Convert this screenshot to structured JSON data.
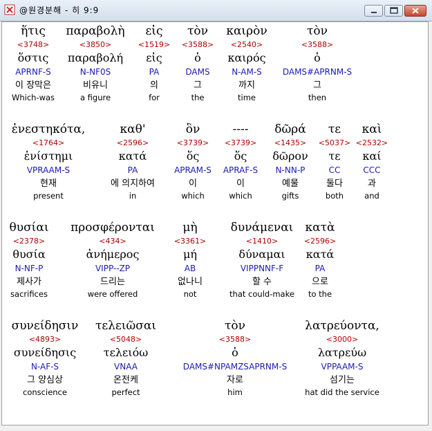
{
  "window": {
    "title": "@원경분해 - 히 9:9",
    "minimize_icon": "minimize-icon",
    "maximize_icon": "maximize-icon",
    "close_icon": "close-icon"
  },
  "words": [
    {
      "greek": "ἥτις",
      "strong": "<3748>",
      "lemma": "ὅστις",
      "morph": "APRNF-S",
      "korean": "이 장막은",
      "english": "Which-was"
    },
    {
      "greek": "παραβολὴ",
      "strong": "<3850>",
      "lemma": "παραβολή",
      "morph": "N-NF0S",
      "korean": "비유니",
      "english": "a figure"
    },
    {
      "greek": "εἰς",
      "strong": "<1519>",
      "lemma": "εἰς",
      "morph": "PA",
      "korean": "의",
      "english": "for"
    },
    {
      "greek": "τὸν",
      "strong": "<3588>",
      "lemma": "ὁ",
      "morph": "DAMS",
      "korean": "그",
      "english": "the"
    },
    {
      "greek": "καιρὸν",
      "strong": "<2540>",
      "lemma": "καιρός",
      "morph": "N-AM-S",
      "korean": "까지",
      "english": "time"
    },
    {
      "greek": "τὸν",
      "strong": "<3588>",
      "lemma": "ὁ",
      "morph": "DAMS#APRNM-S",
      "korean": "그",
      "english": "then"
    },
    {
      "greek": "ἐνεστηκότα,",
      "strong": "<1764>",
      "lemma": "ἐνίστημι",
      "morph": "VPRAAM-S",
      "korean": "현재",
      "english": "present"
    },
    {
      "greek": "καθ'",
      "strong": "<2596>",
      "lemma": "κατά",
      "morph": "PA",
      "korean": "에 의지하여",
      "english": "in"
    },
    {
      "greek": "ὃν",
      "strong": "<3739>",
      "lemma": "ὅς",
      "morph": "APRAM-S",
      "korean": "이",
      "english": "which"
    },
    {
      "greek": "----",
      "strong": "<3739>",
      "lemma": "ὅς",
      "morph": "APRAF-S",
      "korean": "이",
      "english": "which"
    },
    {
      "greek": "δῶρά",
      "strong": "<1435>",
      "lemma": "δῶρον",
      "morph": "N-NN-P",
      "korean": "예물",
      "english": "gifts"
    },
    {
      "greek": "τε",
      "strong": "<5037>",
      "lemma": "τε",
      "morph": "CC",
      "korean": "둘다",
      "english": "both"
    },
    {
      "greek": "καὶ",
      "strong": "<2532>",
      "lemma": "καί",
      "morph": "CCC",
      "korean": "과",
      "english": "and"
    },
    {
      "greek": "θυσίαι",
      "strong": "<2378>",
      "lemma": "θυσία",
      "morph": "N-NF-P",
      "korean": "제사가",
      "english": "sacrifices"
    },
    {
      "greek": "προσφέρονται",
      "strong": "<434>",
      "lemma": "ἀνήμερος",
      "morph": "VIPP--ZP",
      "korean": "드리는",
      "english": "were offered"
    },
    {
      "greek": "μὴ",
      "strong": "<3361>",
      "lemma": "μή",
      "morph": "AB",
      "korean": "없나니",
      "english": "not"
    },
    {
      "greek": "δυνάμεναι",
      "strong": "<1410>",
      "lemma": "δύναμαι",
      "morph": "VIPPNNF-F",
      "korean": "할 수",
      "english": "that could-make"
    },
    {
      "greek": "κατὰ",
      "strong": "<2596>",
      "lemma": "κατά",
      "morph": "PA",
      "korean": "으로",
      "english": "to the"
    },
    {
      "greek": "συνείδησιν",
      "strong": "<4893>",
      "lemma": "συνείδησις",
      "morph": "N-AF-S",
      "korean": "그 양심상",
      "english": "conscience"
    },
    {
      "greek": "τελειῶσαι",
      "strong": "<5048>",
      "lemma": "τελειόω",
      "morph": "VNAA",
      "korean": "온전케",
      "english": "perfect"
    },
    {
      "greek": "τὸν",
      "strong": "<3588>",
      "lemma": "ὁ",
      "morph": "DAMS#NPAMZSAPRNM-S",
      "korean": "자로",
      "english": "him"
    },
    {
      "greek": "λατρεύοντα,",
      "strong": "<3000>",
      "lemma": "λατρεύω",
      "morph": "VPPAAM-S",
      "korean": "섬기는",
      "english": "hat did the service"
    }
  ]
}
